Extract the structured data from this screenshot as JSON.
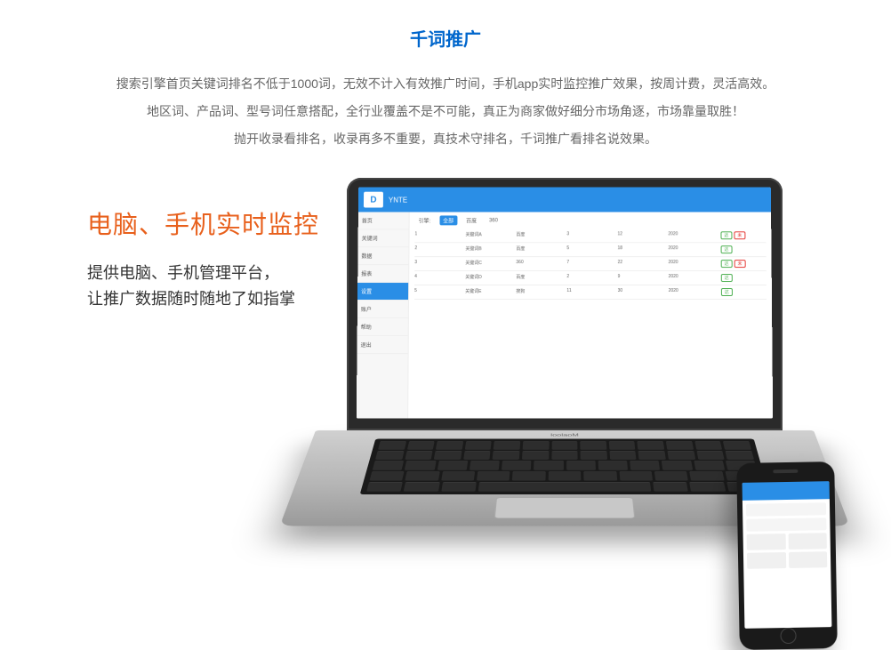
{
  "title": "千词推广",
  "desc": {
    "line1": "搜索引擎首页关键词排名不低于1000词，无效不计入有效推广时间，手机app实时监控推广效果，按周计费，灵活高效。",
    "line2": "地区词、产品词、型号词任意搭配，全行业覆盖不是不可能，真正为商家做好细分市场角逐，市场靠量取胜！",
    "line3": "抛开收录看排名，收录再多不重要，真技术守排名，千词推广看排名说效果。"
  },
  "hero": {
    "title": "电脑、手机实时监控",
    "sub1": "提供电脑、手机管理平台，",
    "sub2": "让推广数据随时随地了如指掌"
  },
  "laptop_label": "loolaoM",
  "app": {
    "logo": "D",
    "header": "YNTE",
    "sidebar": [
      "首页",
      "关键词",
      "数据",
      "报表",
      "设置",
      "账户",
      "帮助",
      "退出"
    ],
    "filter1": "全部",
    "filter2": "百度",
    "filter3": "360"
  }
}
